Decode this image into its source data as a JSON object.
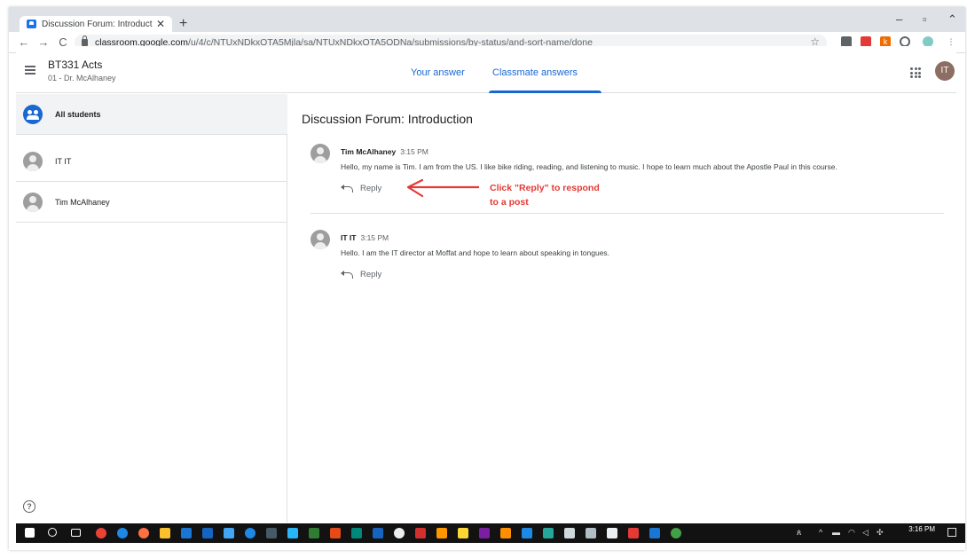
{
  "browser": {
    "tab_title": "Discussion Forum: Introduction",
    "tab_close": "✕",
    "new_tab": "+",
    "url_host": "classroom.google.com",
    "url_path": "/u/4/c/NTUxNDkxOTA5Mjla/sa/NTUxNDkxOTA5ODNa/submissions/by-status/and-sort-name/done"
  },
  "header": {
    "course_title": "BT331 Acts",
    "course_subtitle": "01 - Dr. McAlhaney",
    "tabs": [
      {
        "label": "Your answer",
        "active": false
      },
      {
        "label": "Classmate answers",
        "active": true
      }
    ],
    "avatar_initials": "IT"
  },
  "sidebar": {
    "items": [
      {
        "label": "All students",
        "icon": "group-icon",
        "selected": true
      },
      {
        "label": "IT IT",
        "icon": "person-icon",
        "selected": false
      },
      {
        "label": "Tim McAlhaney",
        "icon": "person-icon",
        "selected": false
      }
    ],
    "help_glyph": "?"
  },
  "main": {
    "heading": "Discussion Forum: Introduction",
    "posts": [
      {
        "author": "Tim McAlhaney",
        "time": "3:15 PM",
        "text": "Hello, my name is Tim. I am from the US. I like bike riding, reading, and listening to music. I hope to learn much about the Apostle Paul in this course.",
        "reply_label": "Reply"
      },
      {
        "author": "IT IT",
        "time": "3:15 PM",
        "text": "Hello. I am the IT director at Moffat and hope to learn about speaking in tongues.",
        "reply_label": "Reply"
      }
    ],
    "annotation": {
      "line1": "Click \"Reply\" to respond",
      "line2": "to a post",
      "color": "#e53935"
    }
  },
  "taskbar": {
    "clock_time": "3:16 PM"
  },
  "colors": {
    "accent": "#1967d2",
    "avatar": "#8d6e63"
  }
}
